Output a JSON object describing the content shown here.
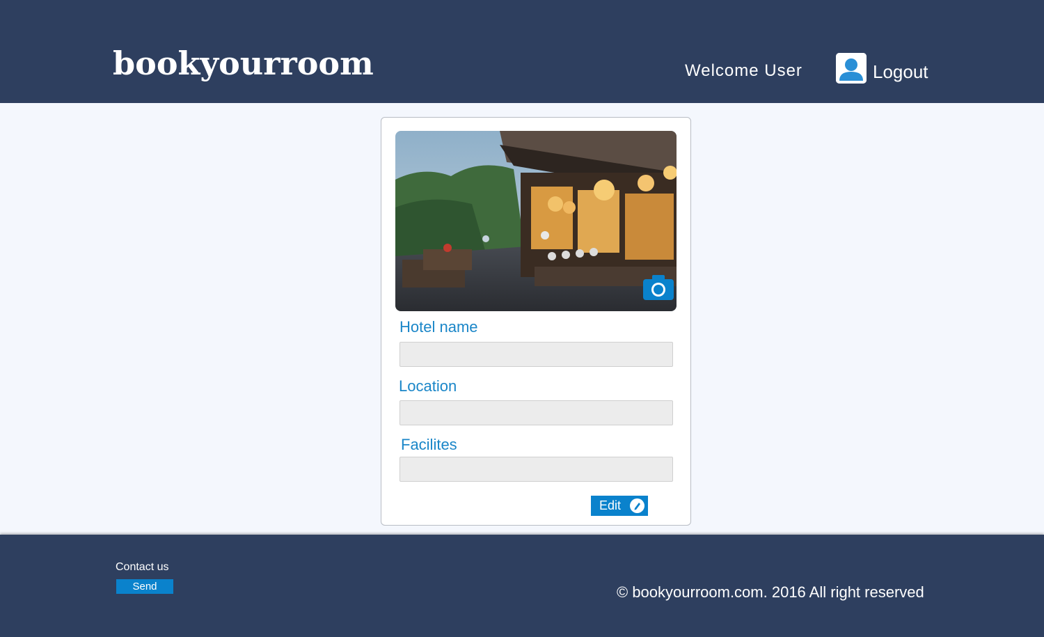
{
  "header": {
    "logo": "bookyourroom",
    "welcome": "Welcome User",
    "user_icon": "user-avatar-icon",
    "logout": "Logout"
  },
  "form": {
    "photo_alt": "Hotel restaurant terrace",
    "camera_icon": "camera-icon",
    "hotel_name_label": "Hotel name",
    "hotel_name_value": "",
    "location_label": "Location",
    "location_value": "",
    "facilities_label": "Facilites",
    "facilities_value": "",
    "edit_label": "Edit",
    "edit_icon": "pencil-icon"
  },
  "footer": {
    "contact": "Contact us",
    "send": "Send",
    "copyright": "© bookyourroom.com. 2016 All right reserved"
  },
  "colors": {
    "header_bg": "#2e3f5f",
    "accent": "#0a82cc",
    "label": "#1a86c8",
    "page_bg": "#f4f7fd"
  }
}
